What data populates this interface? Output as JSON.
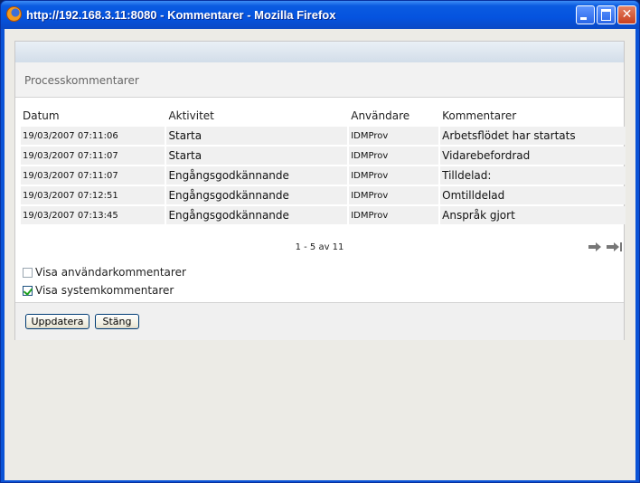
{
  "window": {
    "title": "http://192.168.3.11:8080 - Kommentarer - Mozilla Firefox",
    "icon": "firefox-icon"
  },
  "section": {
    "title": "Processkommentarer"
  },
  "table": {
    "headers": [
      "Datum",
      "Aktivitet",
      "Användare",
      "Kommentarer"
    ],
    "rows": [
      [
        "19/03/2007 07:11:06",
        "Starta",
        "IDMProv",
        "Arbetsflödet har startats"
      ],
      [
        "19/03/2007 07:11:07",
        "Starta",
        "IDMProv",
        "Vidarebefordrad"
      ],
      [
        "19/03/2007 07:11:07",
        "Engångsgodkännande",
        "IDMProv",
        "Tilldelad:"
      ],
      [
        "19/03/2007 07:12:51",
        "Engångsgodkännande",
        "IDMProv",
        "Omtilldelad"
      ],
      [
        "19/03/2007 07:13:45",
        "Engångsgodkännande",
        "IDMProv",
        "Anspråk gjort"
      ]
    ]
  },
  "pager": {
    "text": "1 - 5 av 11"
  },
  "options": {
    "user_comments_label": "Visa användarkommentarer",
    "user_comments_checked": false,
    "system_comments_label": "Visa systemkommentarer",
    "system_comments_checked": true
  },
  "buttons": {
    "update": "Uppdatera",
    "close": "Stäng"
  },
  "colors": {
    "titlebar": "#0553df",
    "row_bg": "#f0f0f0",
    "checkmark": "#21a121"
  }
}
